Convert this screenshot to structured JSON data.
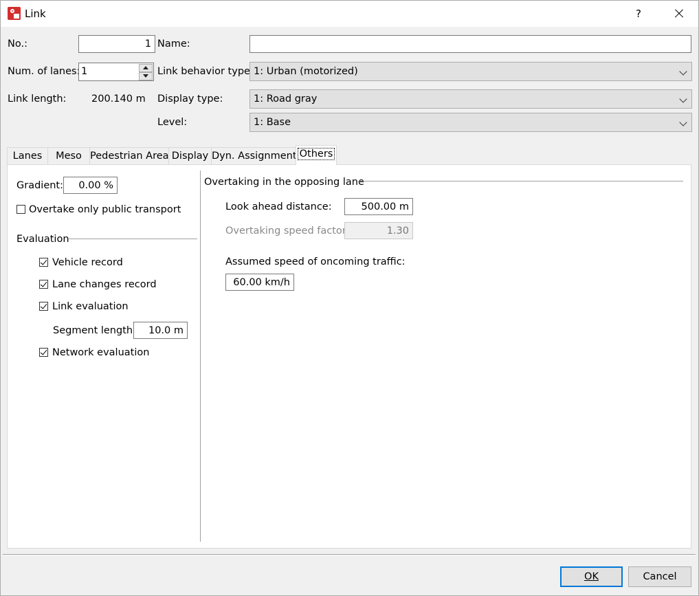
{
  "window": {
    "title": "Link",
    "help": "?"
  },
  "header": {
    "no_label": "No.:",
    "no_value": "1",
    "name_label": "Name:",
    "name_value": "",
    "lanes_label": "Num. of lanes:",
    "lanes_value": "1",
    "link_length_label": "Link length:",
    "link_length_value": "200.140 m",
    "behavior_label": "Link behavior type:",
    "behavior_value": "1: Urban (motorized)",
    "display_label": "Display type:",
    "display_value": "1: Road gray",
    "level_label": "Level:",
    "level_value": "1: Base"
  },
  "tabs": [
    "Lanes",
    "Meso",
    "Pedestrian Area",
    "Display",
    "Dyn. Assignment",
    "Others"
  ],
  "active_tab": "Others",
  "others": {
    "gradient_label": "Gradient:",
    "gradient_value": "0.00 %",
    "overtake_pt_label": "Overtake only public transport",
    "overtake_pt_checked": false,
    "evaluation_title": "Evaluation",
    "vehicle_record_label": "Vehicle record",
    "vehicle_record_checked": true,
    "lane_changes_label": "Lane changes record",
    "lane_changes_checked": true,
    "link_eval_label": "Link evaluation",
    "link_eval_checked": true,
    "segment_length_label": "Segment length:",
    "segment_length_value": "10.0 m",
    "network_eval_label": "Network evaluation",
    "network_eval_checked": true,
    "overtaking_title": "Overtaking in the opposing lane",
    "look_ahead_label": "Look ahead distance:",
    "look_ahead_value": "500.00 m",
    "speed_factor_label": "Overtaking speed factor:",
    "speed_factor_value": "1.30",
    "oncoming_label": "Assumed speed of oncoming traffic:",
    "oncoming_value": "60.00 km/h"
  },
  "footer": {
    "ok_label": "OK",
    "cancel_label": "Cancel"
  }
}
